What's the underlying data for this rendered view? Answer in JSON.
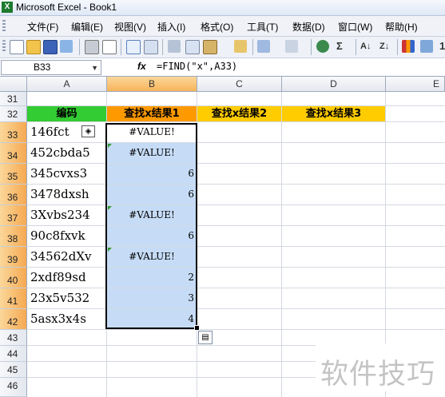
{
  "window": {
    "title": "Microsoft Excel - Book1",
    "app_icon": "excel-icon"
  },
  "menu": [
    "文件(F)",
    "编辑(E)",
    "视图(V)",
    "插入(I)",
    "格式(O)",
    "工具(T)",
    "数据(D)",
    "窗口(W)",
    "帮助(H)"
  ],
  "toolbar": {
    "autosum": "Σ",
    "sort_az": "A↓",
    "sort_za": "Z↓",
    "help": "1"
  },
  "formula_bar": {
    "name_box": "B33",
    "fx": "fx",
    "formula": "=FIND(\"x\",A33)"
  },
  "columns": [
    "A",
    "B",
    "C",
    "D",
    "E"
  ],
  "rows": [
    "31",
    "32",
    "33",
    "34",
    "35",
    "36",
    "37",
    "38",
    "39",
    "40",
    "41",
    "42",
    "43",
    "44",
    "45",
    "46"
  ],
  "headers": {
    "a": "编码",
    "b": "查找x结果1",
    "c": "查找x结果2",
    "d": "查找x结果3"
  },
  "data": [
    {
      "code": "146fct",
      "result": "#VALUE!"
    },
    {
      "code": "452cbda5",
      "result": "#VALUE!"
    },
    {
      "code": "345cvxs3",
      "result": "6"
    },
    {
      "code": "3478dxsh",
      "result": "6"
    },
    {
      "code": "3Xvbs234",
      "result": "#VALUE!"
    },
    {
      "code": "90c8fxvk",
      "result": "6"
    },
    {
      "code": "34562dXv",
      "result": "#VALUE!"
    },
    {
      "code": "2xdf89sd",
      "result": "2"
    },
    {
      "code": "23x5v532",
      "result": "3"
    },
    {
      "code": "5asx3x4s",
      "result": "4"
    }
  ],
  "colors": {
    "header_a": "#33cc33",
    "header_b": "#ff9900",
    "header_cd": "#ffcc00",
    "selection": "#c6dcf6",
    "row_highlight": "#f5a951"
  },
  "watermark": "软件技巧"
}
